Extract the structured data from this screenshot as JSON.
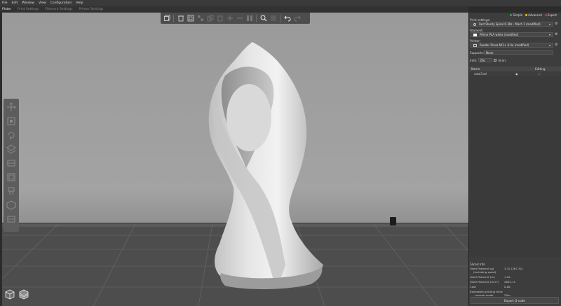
{
  "menu": [
    "File",
    "Edit",
    "Window",
    "View",
    "Configuration",
    "Help"
  ],
  "tabs": [
    {
      "label": "Plater",
      "active": true
    },
    {
      "label": "Print Settings",
      "active": false
    },
    {
      "label": "Filament Settings",
      "active": false
    },
    {
      "label": "Printer Settings",
      "active": false
    }
  ],
  "modes": [
    {
      "label": "Simple",
      "color": "#3fa34d"
    },
    {
      "label": "Advanced",
      "color": "#e6c300"
    },
    {
      "label": "Expert",
      "color": "#d23b3b"
    }
  ],
  "sidebar": {
    "print_settings_label": "Print settings:",
    "print_settings_value": "Fast Sturdy Spiral 0.36z - Mach 1 (modified)",
    "filament_label": "Filament:",
    "filament_value": "Prlline PLA white (modified)",
    "filament_color": "#ffffff",
    "printer_label": "Printer:",
    "printer_value": "Reeder Prusa Mi2+ 0.4n (modified)",
    "supports_label": "Supports:",
    "supports_value": "None",
    "infill_label": "Infill:",
    "infill_value": "0%",
    "brim_label": "Brim:",
    "list_name_header": "Name",
    "list_editing_header": "Editing",
    "object_name": "vase3.stl"
  },
  "sliced_info": {
    "title": "Sliced Info",
    "rows": [
      {
        "key": "Used Filament (g)",
        "value": "3.32 (267.32)"
      },
      {
        "key": "(including spool)",
        "value": ""
      },
      {
        "key": "Used Filament (m)",
        "value": "1.10"
      },
      {
        "key": "Used Filament (mm³)",
        "value": "2655.11"
      },
      {
        "key": "Cost",
        "value": "0.06"
      },
      {
        "key": "Estimated printing time:",
        "value": ""
      },
      {
        "key": "- normal mode",
        "value": "23m"
      }
    ],
    "export_label": "Export G-code"
  },
  "colors": {
    "accent": "#e06c1f"
  }
}
